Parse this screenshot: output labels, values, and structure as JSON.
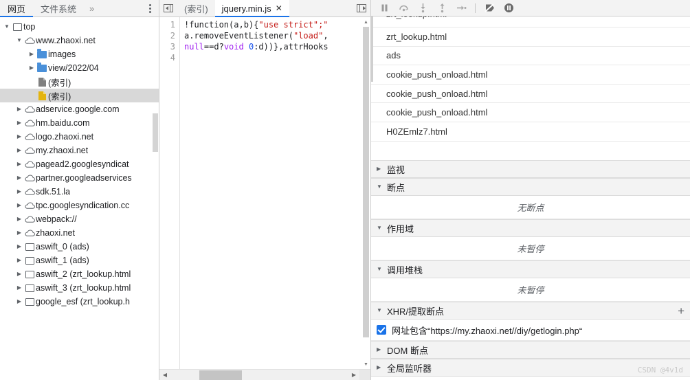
{
  "navigator": {
    "tabs": [
      {
        "label": "网页",
        "active": true
      },
      {
        "label": "文件系统",
        "active": false
      }
    ],
    "overflow_label": "»",
    "menu_icon": "kebab-menu-icon",
    "tree": [
      {
        "label": "top",
        "icon": "frame-icon",
        "twist": "open",
        "indent": 0,
        "selected": false
      },
      {
        "label": "www.zhaoxi.net",
        "icon": "cloud-icon",
        "twist": "open",
        "indent": 1,
        "selected": false
      },
      {
        "label": "images",
        "icon": "folder-icon",
        "twist": "closed",
        "indent": 2,
        "selected": false
      },
      {
        "label": "view/2022/04",
        "icon": "folder-icon",
        "twist": "closed",
        "indent": 2,
        "selected": false
      },
      {
        "label": "(索引)",
        "icon": "document-gray-icon",
        "twist": "none",
        "indent": 2,
        "selected": false
      },
      {
        "label": "(索引)",
        "icon": "document-yellow-icon",
        "twist": "none",
        "indent": 2,
        "selected": true
      },
      {
        "label": "adservice.google.com",
        "icon": "cloud-icon",
        "twist": "closed",
        "indent": 1,
        "selected": false
      },
      {
        "label": "hm.baidu.com",
        "icon": "cloud-icon",
        "twist": "closed",
        "indent": 1,
        "selected": false
      },
      {
        "label": "logo.zhaoxi.net",
        "icon": "cloud-icon",
        "twist": "closed",
        "indent": 1,
        "selected": false
      },
      {
        "label": "my.zhaoxi.net",
        "icon": "cloud-icon",
        "twist": "closed",
        "indent": 1,
        "selected": false
      },
      {
        "label": "pagead2.googlesyndicat",
        "icon": "cloud-icon",
        "twist": "closed",
        "indent": 1,
        "selected": false
      },
      {
        "label": "partner.googleadservices",
        "icon": "cloud-icon",
        "twist": "closed",
        "indent": 1,
        "selected": false
      },
      {
        "label": "sdk.51.la",
        "icon": "cloud-icon",
        "twist": "closed",
        "indent": 1,
        "selected": false
      },
      {
        "label": "tpc.googlesyndication.cc",
        "icon": "cloud-icon",
        "twist": "closed",
        "indent": 1,
        "selected": false
      },
      {
        "label": "webpack://",
        "icon": "cloud-icon",
        "twist": "closed",
        "indent": 1,
        "selected": false
      },
      {
        "label": "zhaoxi.net",
        "icon": "cloud-icon",
        "twist": "closed",
        "indent": 1,
        "selected": false
      },
      {
        "label": "aswift_0 (ads)",
        "icon": "frame-icon",
        "twist": "closed",
        "indent": 1,
        "selected": false
      },
      {
        "label": "aswift_1 (ads)",
        "icon": "frame-icon",
        "twist": "closed",
        "indent": 1,
        "selected": false
      },
      {
        "label": "aswift_2 (zrt_lookup.html",
        "icon": "frame-icon",
        "twist": "closed",
        "indent": 1,
        "selected": false
      },
      {
        "label": "aswift_3 (zrt_lookup.html",
        "icon": "frame-icon",
        "twist": "closed",
        "indent": 1,
        "selected": false
      },
      {
        "label": "google_esf (zrt_lookup.h",
        "icon": "frame-icon",
        "twist": "closed",
        "indent": 1,
        "selected": false
      }
    ]
  },
  "editor": {
    "navigator_toggle_icon": "show-navigator-icon",
    "sidebar_toggle_icon": "show-debugger-icon",
    "tabs": [
      {
        "label": "(索引)",
        "active": false,
        "closable": false
      },
      {
        "label": "jquery.min.js",
        "active": true,
        "closable": true
      }
    ],
    "close_glyph": "✕",
    "lines": [
      {
        "num": "1",
        "tokens": [
          {
            "t": "!function(a,b){",
            "c": "plain"
          },
          {
            "t": "\"use strict\";",
            "c": "string"
          },
          {
            "t": "\"",
            "c": "string"
          }
        ]
      },
      {
        "num": "2",
        "tokens": [
          {
            "t": "a.removeEventListener(",
            "c": "plain"
          },
          {
            "t": "\"load\"",
            "c": "string"
          },
          {
            "t": ",",
            "c": "plain"
          }
        ]
      },
      {
        "num": "3",
        "tokens": [
          {
            "t": "null",
            "c": "keyword"
          },
          {
            "t": "==d?",
            "c": "plain"
          },
          {
            "t": "void",
            "c": "keyword"
          },
          {
            "t": " ",
            "c": "plain"
          },
          {
            "t": "0",
            "c": "number"
          },
          {
            "t": ":d))},attrHooks",
            "c": "plain"
          }
        ]
      },
      {
        "num": "4",
        "tokens": []
      }
    ]
  },
  "debugger": {
    "toolbar": [
      {
        "name": "resume-pause-button",
        "glyph": "pause"
      },
      {
        "name": "step-over-button",
        "glyph": "step-over"
      },
      {
        "name": "step-into-button",
        "glyph": "step-into"
      },
      {
        "name": "step-out-button",
        "glyph": "step-out"
      },
      {
        "name": "step-button",
        "glyph": "step"
      },
      {
        "name": "deactivate-breakpoints-button",
        "glyph": "deactivate"
      },
      {
        "name": "pause-on-exceptions-button",
        "glyph": "pause-exceptions"
      }
    ],
    "stack_files": [
      "zrt_lookup.html",
      "zrt_lookup.html",
      "ads",
      "cookie_push_onload.html",
      "cookie_push_onload.html",
      "cookie_push_onload.html",
      "H0ZEmlz7.html"
    ],
    "sections": [
      {
        "title": "监视",
        "expanded": false,
        "body": null,
        "plus": false
      },
      {
        "title": "断点",
        "expanded": true,
        "body": "无断点",
        "plus": false
      },
      {
        "title": "作用域",
        "expanded": true,
        "body": "未暂停",
        "plus": false
      },
      {
        "title": "调用堆栈",
        "expanded": true,
        "body": "未暂停",
        "plus": false
      }
    ],
    "xhr": {
      "title": "XHR/提取断点",
      "expanded": true,
      "add_label": "+",
      "breakpoint_label": "网址包含“https://my.zhaoxi.net//diy/getlogin.php“",
      "checked": true
    },
    "tail_sections": [
      {
        "title": "DOM 断点",
        "expanded": false
      },
      {
        "title": "全局监听器",
        "expanded": false
      }
    ],
    "watermark": "CSDN @4v1d"
  },
  "colors": {
    "accent": "#1a73e8",
    "folder": "#4a90d9",
    "doc_yellow": "#e3b410",
    "doc_gray": "#808080",
    "header_bg": "#f3f3f3",
    "selected_row": "#d8d8d8"
  }
}
